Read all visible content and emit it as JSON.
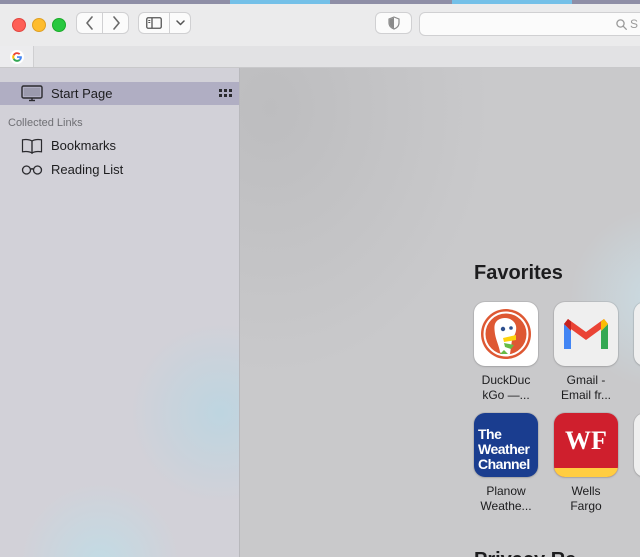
{
  "toolbar": {
    "address_placeholder": "S",
    "icons": [
      "back-chevron-icon",
      "forward-chevron-icon",
      "sidebar-icon",
      "chevron-down-icon",
      "shield-icon",
      "search-icon"
    ]
  },
  "tabs": [
    {
      "icon": "google-icon",
      "label": "G"
    }
  ],
  "sidebar": {
    "start_page": "Start Page",
    "section_header": "Collected Links",
    "items": [
      {
        "label": "Bookmarks",
        "icon": "book-icon"
      },
      {
        "label": "Reading List",
        "icon": "glasses-icon"
      }
    ]
  },
  "main": {
    "favorites_title": "Favorites",
    "favorites": [
      {
        "line1": "DuckDuc",
        "line2": "kGo —...",
        "icon": "duckduckgo-icon"
      },
      {
        "line1": "Gmail -",
        "line2": "Email fr...",
        "icon": "gmail-icon"
      },
      {
        "line1": "Planow",
        "line2": "Weathe...",
        "icon": "weather-channel-icon",
        "logo_text": [
          "The",
          "Weather",
          "Channel"
        ]
      },
      {
        "line1": "Wells",
        "line2": "Fargo",
        "icon": "wells-fargo-icon",
        "logo_text": "WF"
      }
    ],
    "next_section_title": "Privacy Re"
  },
  "colors": {
    "accent_selection": "#b0aec3",
    "weather_blue": "#1a3d8f",
    "wells_red": "#cf1f2d",
    "wells_yellow": "#ffcd41",
    "duck_orange": "#de5833"
  }
}
